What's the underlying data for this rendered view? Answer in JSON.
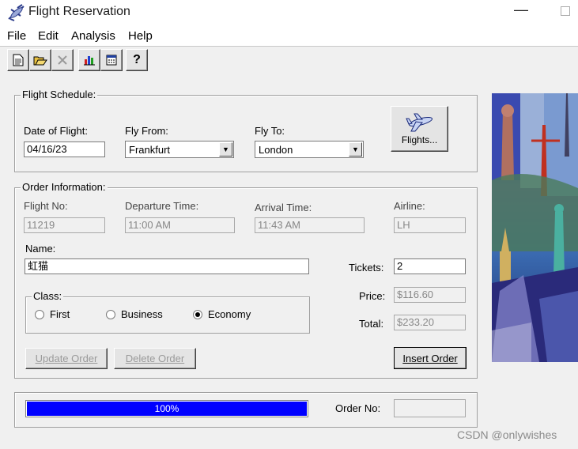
{
  "window": {
    "title": "Flight Reservation",
    "minimize": "—"
  },
  "menu": [
    "File",
    "Edit",
    "Analysis",
    "Help"
  ],
  "toolbar": [
    "new-icon",
    "open-icon",
    "delete-icon",
    "chart-icon",
    "calculator-icon",
    "help-icon"
  ],
  "toolbar_help_glyph": "?",
  "schedule": {
    "group_label": "Flight Schedule:",
    "date_label": "Date of Flight:",
    "date_value": "04/16/23",
    "from_label": "Fly From:",
    "from_value": "Frankfurt",
    "to_label": "Fly To:",
    "to_value": "London",
    "flights_button": "Flights..."
  },
  "order": {
    "group_label": "Order Information:",
    "flight_no_label": "Flight No:",
    "flight_no": "11219",
    "departure_label": "Departure Time:",
    "departure": "11:00 AM",
    "arrival_label": "Arrival Time:",
    "arrival": "11:43 AM",
    "airline_label": "Airline:",
    "airline": "LH",
    "name_label": "Name:",
    "name": "虹猫",
    "tickets_label": "Tickets:",
    "tickets": "2",
    "price_label": "Price:",
    "price": "$116.60",
    "total_label": "Total:",
    "total": "$233.20",
    "class_label": "Class:",
    "class_first": "First",
    "class_business": "Business",
    "class_economy": "Economy",
    "class_selected": "Economy",
    "update_button": "Update Order",
    "delete_button": "Delete Order",
    "insert_button": "Insert Order"
  },
  "status": {
    "progress_text": "100%",
    "progress_value": 100,
    "order_no_label": "Order No:",
    "order_no": ""
  },
  "colors": {
    "progress": "#0000ff",
    "background": "#f0f0f0"
  },
  "watermark": "CSDN @onlywishes"
}
